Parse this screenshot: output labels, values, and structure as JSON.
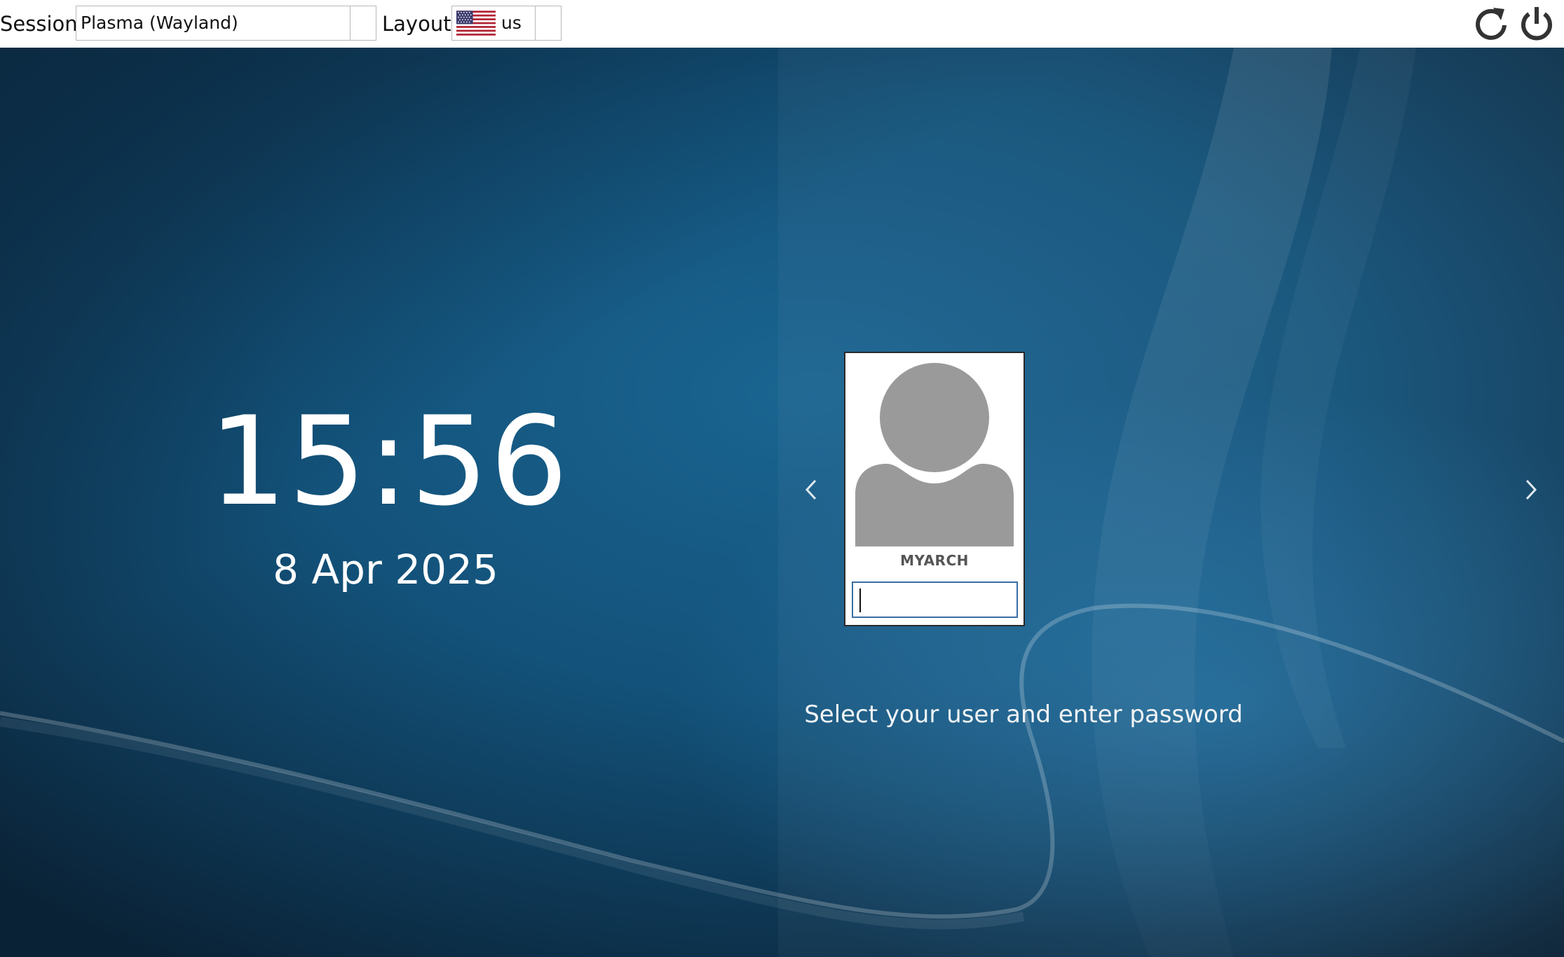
{
  "topbar": {
    "session_label": "Session",
    "session_value": "Plasma (Wayland)",
    "layout_label": "Layout",
    "layout_value": "us",
    "layout_flag_icon": "us-flag-icon",
    "reboot_icon": "reboot-icon",
    "shutdown_icon": "shutdown-icon"
  },
  "clock": {
    "time": "15:56",
    "date": "8 Apr 2025"
  },
  "login": {
    "username": "MYARCH",
    "password_value": "",
    "prompt": "Select your user and enter password",
    "prev_icon": "chevron-left-icon",
    "next_icon": "chevron-right-icon"
  },
  "colors": {
    "background_dark": "#0a2236",
    "background_mid": "#175a85",
    "topbar": "#ffffff",
    "avatar_gray": "#9a9a9a",
    "input_border": "#3b6ea5"
  }
}
